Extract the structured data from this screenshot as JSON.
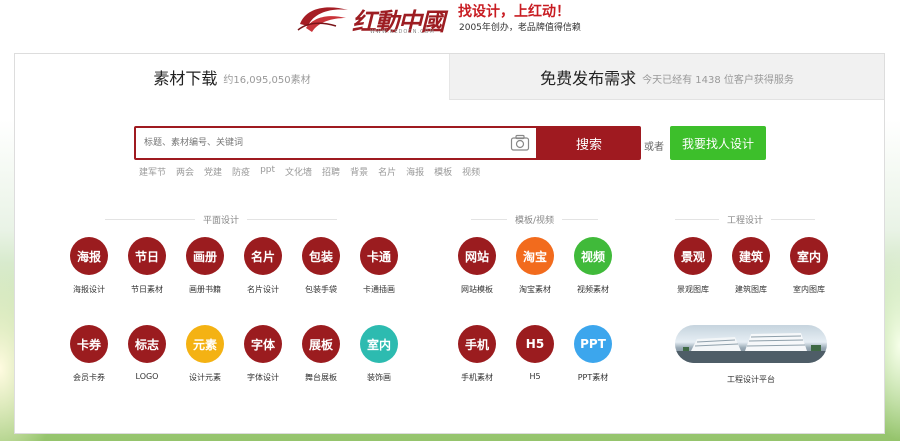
{
  "header": {
    "logo_text": "红動中國",
    "logo_url": "WWW.REDOCN.COM",
    "slogan_main": "找设计，上红动！",
    "slogan_sub": "2005年创办，老品牌值得信赖"
  },
  "tabs": [
    {
      "title": "素材下载",
      "sub": "约16,095,050素材"
    },
    {
      "title": "免费发布需求",
      "sub": "今天已经有 1438 位客户获得服务"
    }
  ],
  "search": {
    "placeholder": "标题、素材编号、关键词",
    "button_label": "搜索",
    "or_text": "或者",
    "find_designer_label": "我要找人设计",
    "hot_words": [
      "建军节",
      "两会",
      "党建",
      "防疫",
      "ppt",
      "文化墙",
      "招聘",
      "背景",
      "名片",
      "海报",
      "模板",
      "视频"
    ]
  },
  "sections": {
    "graphic": "平面设计",
    "template": "模板/视频",
    "engineering": "工程设计"
  },
  "categories": [
    {
      "icon": "海报",
      "label": "海报设计",
      "color": "red"
    },
    {
      "icon": "节日",
      "label": "节日素材",
      "color": "red"
    },
    {
      "icon": "画册",
      "label": "画册书籍",
      "color": "red"
    },
    {
      "icon": "名片",
      "label": "名片设计",
      "color": "red"
    },
    {
      "icon": "包装",
      "label": "包装手袋",
      "color": "red"
    },
    {
      "icon": "卡通",
      "label": "卡通插画",
      "color": "red"
    },
    {
      "icon": "网站",
      "label": "网站模板",
      "color": "red"
    },
    {
      "icon": "淘宝",
      "label": "淘宝素材",
      "color": "orange"
    },
    {
      "icon": "视频",
      "label": "视频素材",
      "color": "green"
    },
    {
      "icon": "景观",
      "label": "景观图库",
      "color": "red"
    },
    {
      "icon": "建筑",
      "label": "建筑图库",
      "color": "red"
    },
    {
      "icon": "室内",
      "label": "室内图库",
      "color": "red"
    },
    {
      "icon": "卡券",
      "label": "会员卡券",
      "color": "red"
    },
    {
      "icon": "标志",
      "label": "LOGO",
      "color": "red"
    },
    {
      "icon": "元素",
      "label": "设计元素",
      "color": "yellow"
    },
    {
      "icon": "字体",
      "label": "字体设计",
      "color": "red"
    },
    {
      "icon": "展板",
      "label": "舞台展板",
      "color": "red"
    },
    {
      "icon": "室内",
      "label": "装饰画",
      "color": "teal"
    },
    {
      "icon": "手机",
      "label": "手机素材",
      "color": "red"
    },
    {
      "icon": "H5",
      "label": "H5",
      "color": "red"
    },
    {
      "icon": "PPT",
      "label": "PPT素材",
      "color": "blue"
    }
  ],
  "engineering_platform_label": "工程设计平台",
  "colors": {
    "brand_red": "#9f1a20",
    "accent_green": "#3dbf2b"
  }
}
